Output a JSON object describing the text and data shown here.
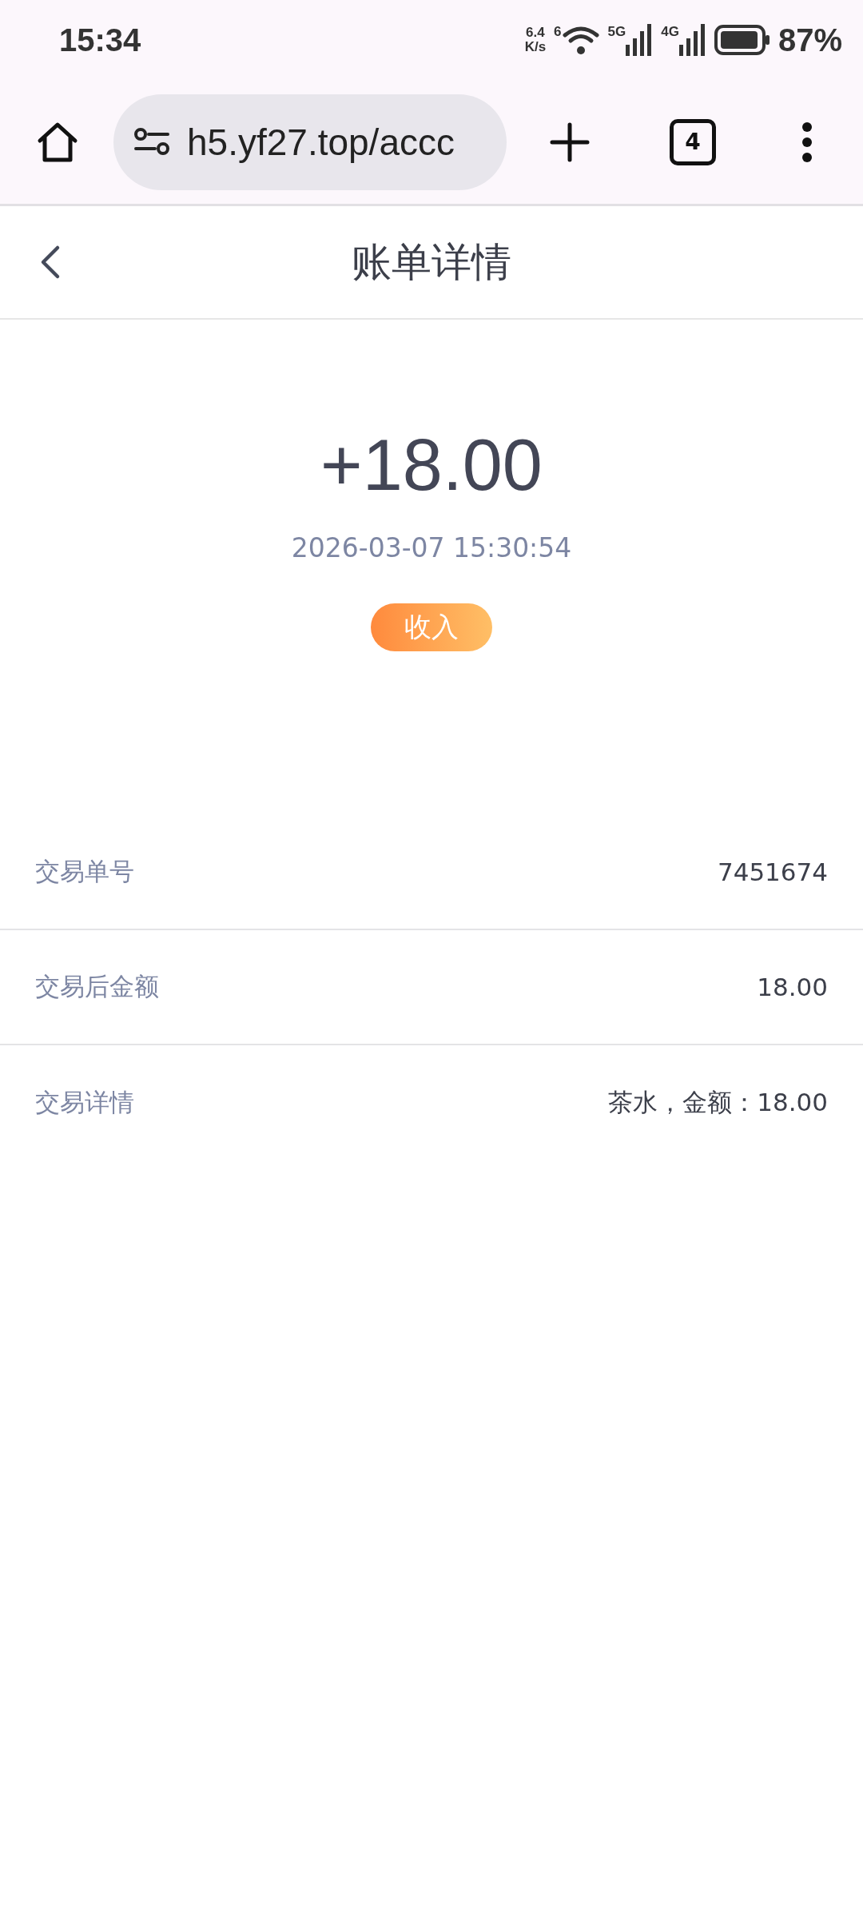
{
  "status_bar": {
    "time": "15:34",
    "net_speed_value": "6.4",
    "net_speed_unit": "K/s",
    "wifi_label": "6",
    "sim1_label": "5G",
    "sim2_label": "4G",
    "battery_level": "87%"
  },
  "browser": {
    "url": "h5.yf27.top/accc",
    "tab_count": "4"
  },
  "header": {
    "title": "账单详情"
  },
  "summary": {
    "amount": "+18.00",
    "time": "2026-03-07 15:30:54",
    "badge": {
      "label": "收入",
      "kind": "income"
    }
  },
  "details": [
    {
      "label": "交易单号",
      "value": "7451674"
    },
    {
      "label": "交易后金额",
      "value": "18.00"
    },
    {
      "label": "交易详情",
      "value": "茶水，金额：18.00"
    }
  ]
}
